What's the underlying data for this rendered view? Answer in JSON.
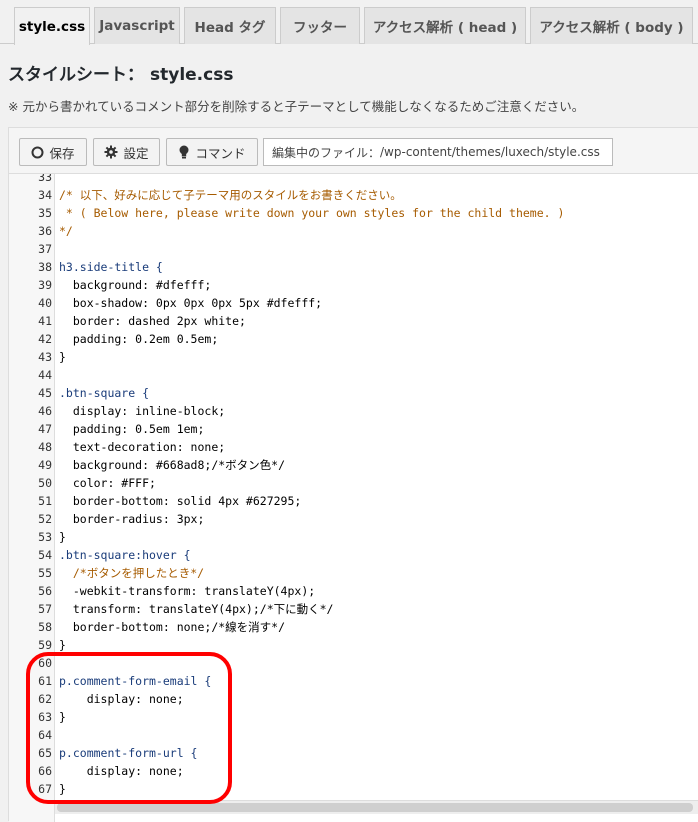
{
  "tabs": [
    {
      "label": "style.css",
      "active": true
    },
    {
      "label": "Javascript",
      "active": false
    },
    {
      "label": "Head タグ",
      "active": false
    },
    {
      "label": "フッター",
      "active": false
    },
    {
      "label": "アクセス解析 ( head )",
      "active": false
    },
    {
      "label": "アクセス解析 ( body )",
      "active": false
    }
  ],
  "page": {
    "title_prefix": "スタイルシート：",
    "title_file": "style.css",
    "notice": "※ 元から書かれているコメント部分を削除すると子テーマとして機能しなくなるためご注意ください。"
  },
  "toolbar": {
    "save_label": "保存",
    "settings_label": "設定",
    "command_label": "コマンド",
    "file_prefix": "編集中のファイル：",
    "file_path": "/wp-content/themes/luxech/style.css"
  },
  "icons": {
    "save": "circle-icon",
    "settings": "gear-icon",
    "command": "lightbulb-icon"
  },
  "colors": {
    "highlight": "#ff0000",
    "comment": "#a65b00",
    "selector": "#1a3c7a"
  },
  "code": {
    "lines": [
      {
        "num": "33",
        "text": ""
      },
      {
        "num": "34",
        "text": "/* 以下、好みに応じて子テーマ用のスタイルをお書きください。",
        "cls": "c-comment"
      },
      {
        "num": "35",
        "text": " * ( Below here, please write down your own styles for the child theme. )",
        "cls": "c-comment"
      },
      {
        "num": "36",
        "text": "*/",
        "cls": "c-comment"
      },
      {
        "num": "37",
        "text": ""
      },
      {
        "num": "38",
        "text": "h3.side-title {",
        "cls": "c-sel"
      },
      {
        "num": "39",
        "text": "  background: #dfefff;"
      },
      {
        "num": "40",
        "text": "  box-shadow: 0px 0px 0px 5px #dfefff;"
      },
      {
        "num": "41",
        "text": "  border: dashed 2px white;"
      },
      {
        "num": "42",
        "text": "  padding: 0.2em 0.5em;"
      },
      {
        "num": "43",
        "text": "}"
      },
      {
        "num": "44",
        "text": ""
      },
      {
        "num": "45",
        "text": ".btn-square {",
        "cls": "c-sel"
      },
      {
        "num": "46",
        "text": "  display: inline-block;"
      },
      {
        "num": "47",
        "text": "  padding: 0.5em 1em;"
      },
      {
        "num": "48",
        "text": "  text-decoration: none;"
      },
      {
        "num": "49",
        "text": "  background: #668ad8;/*ボタン色*/"
      },
      {
        "num": "50",
        "text": "  color: #FFF;"
      },
      {
        "num": "51",
        "text": "  border-bottom: solid 4px #627295;"
      },
      {
        "num": "52",
        "text": "  border-radius: 3px;"
      },
      {
        "num": "53",
        "text": "}"
      },
      {
        "num": "54",
        "text": ".btn-square:hover {",
        "cls": "c-sel"
      },
      {
        "num": "55",
        "text": "  /*ボタンを押したとき*/",
        "cls": "c-comment"
      },
      {
        "num": "56",
        "text": "  -webkit-transform: translateY(4px);"
      },
      {
        "num": "57",
        "text": "  transform: translateY(4px);/*下に動く*/"
      },
      {
        "num": "58",
        "text": "  border-bottom: none;/*線を消す*/"
      },
      {
        "num": "59",
        "text": "}"
      },
      {
        "num": "60",
        "text": ""
      },
      {
        "num": "61",
        "text": "p.comment-form-email {",
        "cls": "c-sel"
      },
      {
        "num": "62",
        "text": "    display: none;"
      },
      {
        "num": "63",
        "text": "}"
      },
      {
        "num": "64",
        "text": ""
      },
      {
        "num": "65",
        "text": "p.comment-form-url {",
        "cls": "c-sel"
      },
      {
        "num": "66",
        "text": "    display: none;"
      },
      {
        "num": "67",
        "text": "}"
      }
    ]
  }
}
